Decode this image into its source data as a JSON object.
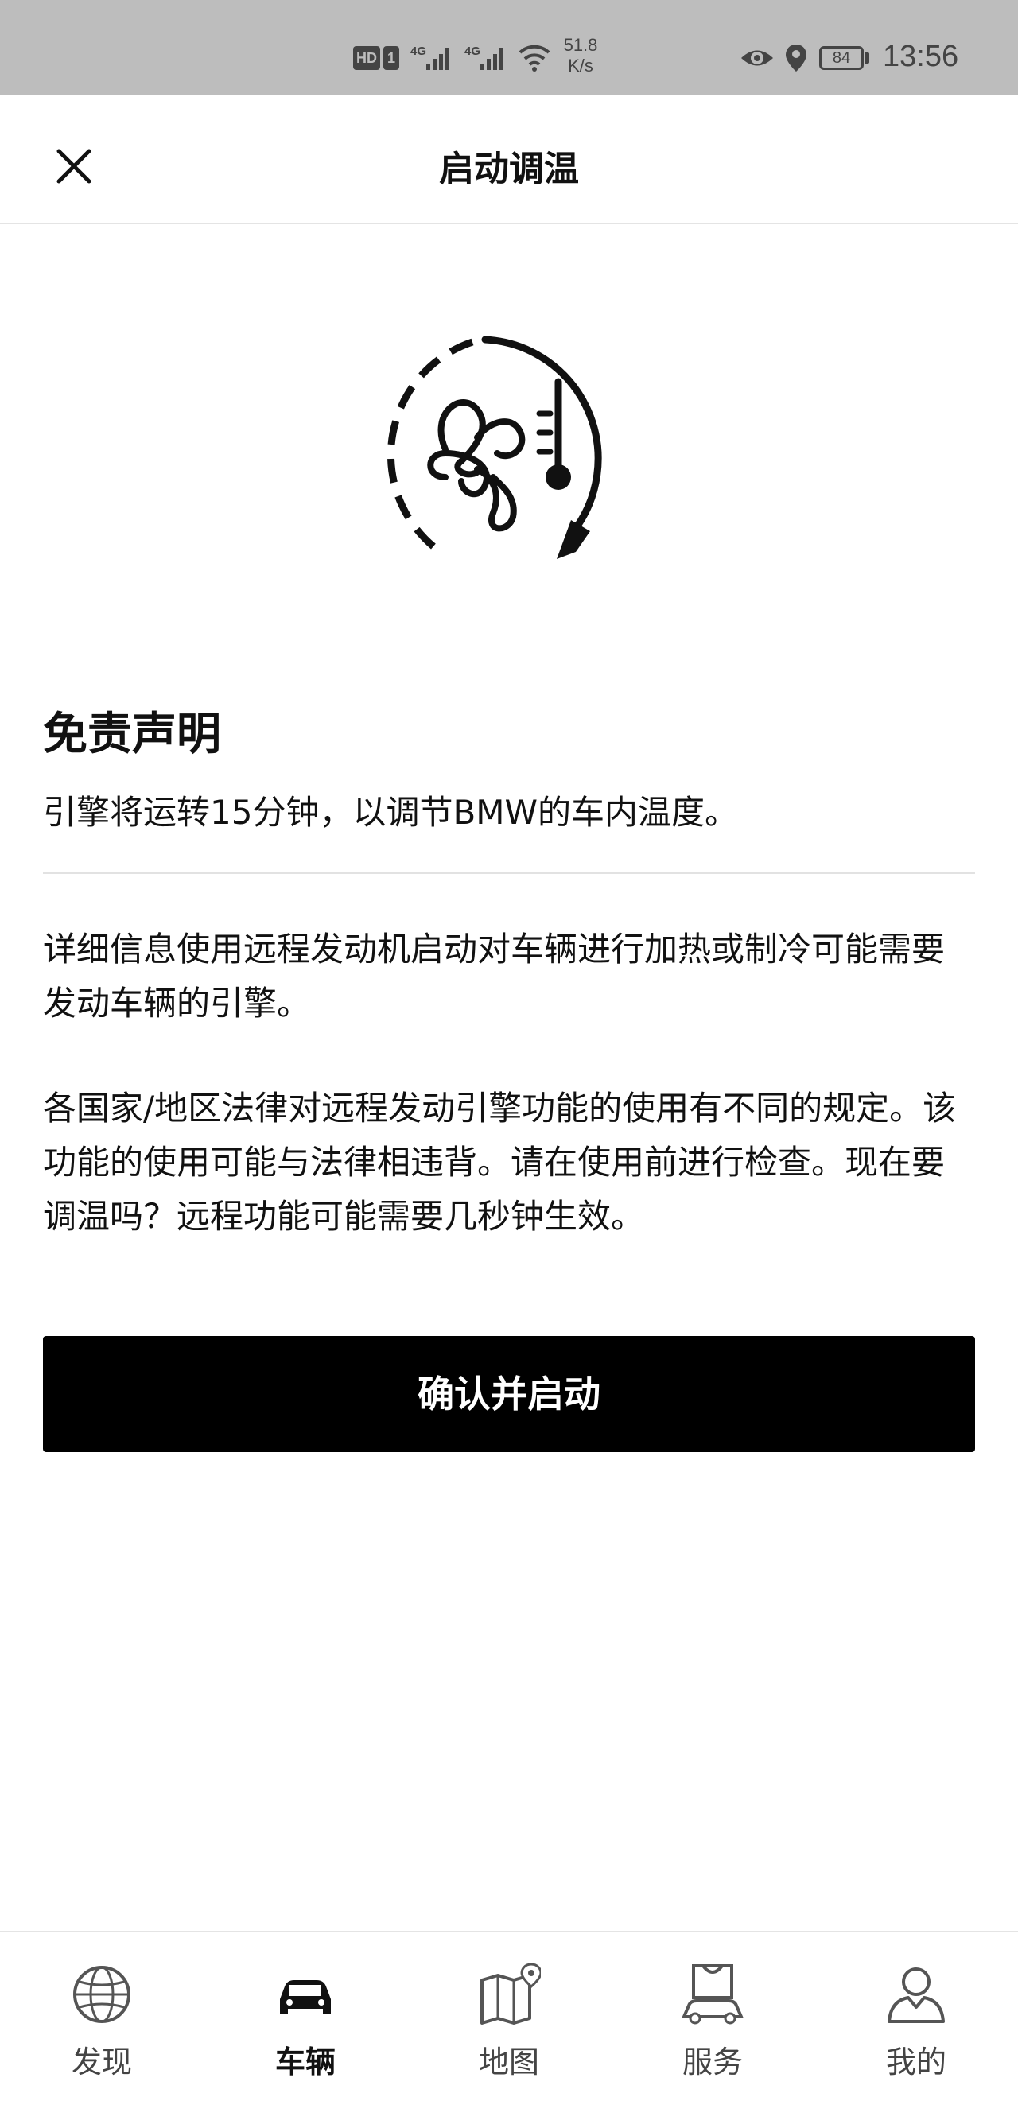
{
  "status_bar": {
    "hd": "HD",
    "sim": "1",
    "network_1": "4G",
    "network_2": "4G",
    "speed_value": "51.8",
    "speed_unit": "K/s",
    "battery": "84",
    "time": "13:56"
  },
  "header": {
    "title": "启动调温"
  },
  "disclaimer": {
    "title": "免责声明",
    "summary": "引擎将运转15分钟，以调节BMW的车内温度。",
    "paragraph_1": "详细信息使用远程发动机启动对车辆进行加热或制冷可能需要发动车辆的引擎。",
    "paragraph_2": "各国家/地区法律对远程发动引擎功能的使用有不同的规定。该功能的使用可能与法律相违背。请在使用前进行检查。现在要调温吗？远程功能可能需要几秒钟生效。"
  },
  "confirm_button": {
    "label": "确认并启动"
  },
  "bottom_nav": {
    "items": [
      {
        "label": "发现",
        "icon": "globe-icon",
        "active": false
      },
      {
        "label": "车辆",
        "icon": "car-icon",
        "active": true
      },
      {
        "label": "地图",
        "icon": "map-icon",
        "active": false
      },
      {
        "label": "服务",
        "icon": "service-icon",
        "active": false
      },
      {
        "label": "我的",
        "icon": "profile-icon",
        "active": false
      }
    ]
  }
}
